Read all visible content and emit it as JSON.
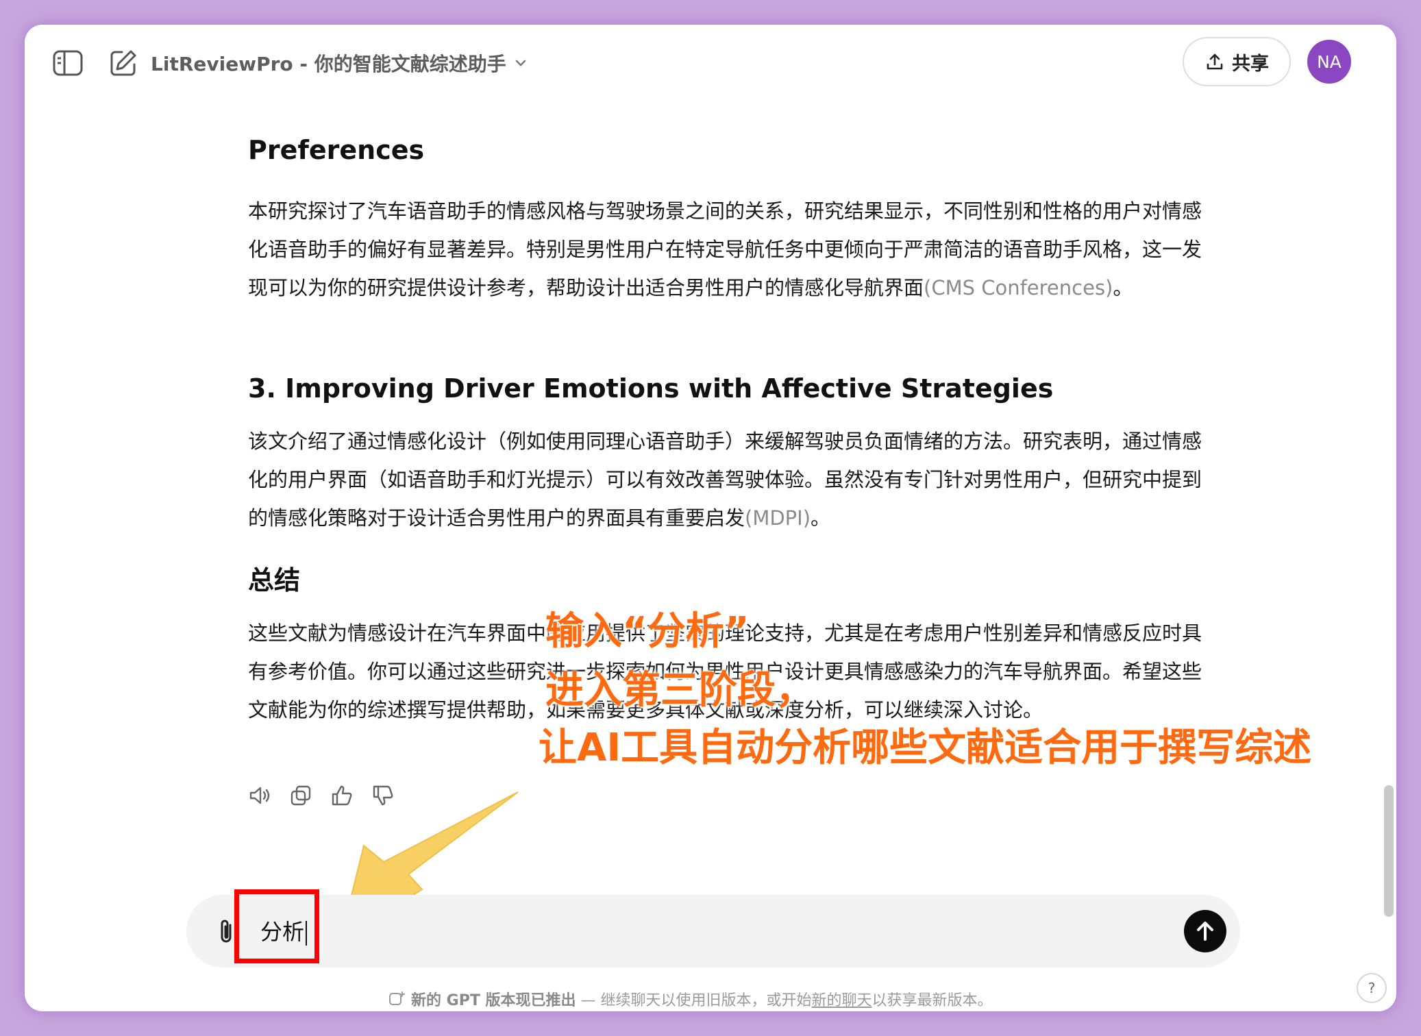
{
  "header": {
    "title": "LitReviewPro - 你的智能文献综述助手",
    "share_label": "共享",
    "avatar_initials": "NA"
  },
  "content": {
    "section2_title_tail": "Preferences",
    "section2_body": "本研究探讨了汽车语音助手的情感风格与驾驶场景之间的关系，研究结果显示，不同性别和性格的用户对情感化语音助手的偏好有显著差异。特别是男性用户在特定导航任务中更倾向于严肃简洁的语音助手风格，这一发现可以为你的研究提供设计参考，帮助设计出适合男性用户的情感化导航界面",
    "section2_cite": "(CMS Conferences)",
    "section2_end": "。",
    "section3_title": "3. Improving Driver Emotions with Affective Strategies",
    "section3_body": "该文介绍了通过情感化设计（例如使用同理心语音助手）来缓解驾驶员负面情绪的方法。研究表明，通过情感化的用户界面（如语音助手和灯光提示）可以有效改善驾驶体验。虽然没有专门针对男性用户，但研究中提到的情感化策略对于设计适合男性用户的界面具有重要启发",
    "section3_cite": "(MDPI)",
    "section3_end": "。",
    "summary_title": "总结",
    "summary_body": "这些文献为情感设计在汽车界面中的应用提供了坚实的理论支持，尤其是在考虑用户性别差异和情感反应时具有参考价值。你可以通过这些研究进一步探索如何为男性用户设计更具情感感染力的汽车导航界面。希望这些文献能为你的综述撰写提供帮助，如果需要更多具体文献或深度分析，可以继续深入讨论。"
  },
  "annotations": {
    "line1": "输入“分析”",
    "line2": "进入第三阶段，",
    "line3": "让AI工具自动分析哪些文献适合用于撰写综述"
  },
  "composer": {
    "value": "分析"
  },
  "footer": {
    "strong": "新的 GPT 版本现已推出",
    "text1": " — 继续聊天以使用旧版本，或开始",
    "link": "新的聊天",
    "text2": "以获享最新版本。"
  },
  "help_label": "?",
  "colors": {
    "accent_annotation": "#ff6a10",
    "avatar_bg": "#8b46c1",
    "highlight_box": "#ff0000",
    "arrow": "#f7cf63"
  }
}
